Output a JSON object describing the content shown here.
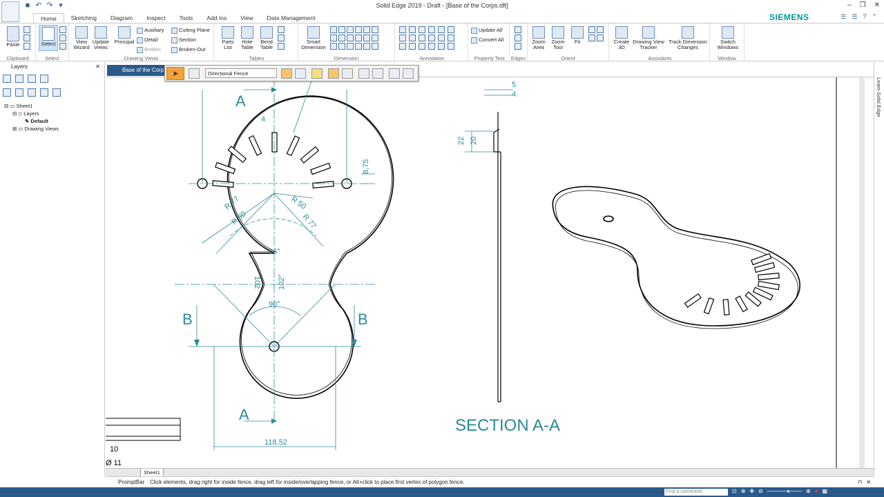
{
  "window": {
    "title": "Solid Edge 2019 - Draft - [Base of the Corps.dft]",
    "brand": "SIEMENS"
  },
  "tabs": [
    "Home",
    "Sketching",
    "Diagram",
    "Inspect",
    "Tools",
    "Add Ins",
    "View",
    "Data Management"
  ],
  "ribbon": {
    "clipboard": {
      "label": "Clipboard",
      "paste": "Paste"
    },
    "select": {
      "label": "Select",
      "select": "Select"
    },
    "drawing_views": {
      "label": "Drawing Views",
      "view_wizard_1": "View",
      "view_wizard_2": "Wizard",
      "update_views_1": "Update",
      "update_views_2": "Views",
      "principal": "Principal",
      "auxiliary": "Auxiliary",
      "detail": "Detail",
      "broken": "Broken",
      "cutting_plane": "Cutting Plane",
      "section": "Section",
      "broken_out": "Broken-Out"
    },
    "tables": {
      "label": "Tables",
      "parts_list_1": "Parts",
      "parts_list_2": "List",
      "hole_table_1": "Hole",
      "hole_table_2": "Table",
      "bend_table_1": "Bend",
      "bend_table_2": "Table"
    },
    "dimension": {
      "label": "Dimension",
      "smart_1": "Smart",
      "smart_2": "Dimension"
    },
    "annotation": {
      "label": "Annotation"
    },
    "property_text": {
      "label": "Property Text",
      "update_all": "Update All",
      "convert_all": "Convert All"
    },
    "edges": {
      "label": "Edges"
    },
    "orient": {
      "label": "Orient",
      "zoom_area_1": "Zoom",
      "zoom_area_2": "Area",
      "zoom_tool_1": "Zoom",
      "zoom_tool_2": "Tool",
      "fit": "Fit"
    },
    "assistants": {
      "label": "Assistants",
      "create3d_1": "Create",
      "create3d_2": "3D",
      "dvt_1": "Drawing View",
      "dvt_2": "Tracker",
      "tdc_1": "Track Dimension",
      "tdc_2": "Changes"
    },
    "window": {
      "label": "Window",
      "switch_1": "Switch",
      "switch_2": "Windows"
    }
  },
  "left_panel": {
    "title": "Layers",
    "tree": {
      "sheet": "Sheet1",
      "layers": "Layers",
      "default": "Default",
      "drawing_views": "Drawing Views"
    }
  },
  "doc_tab": "Base of the Corp",
  "selection_toolbar": {
    "mode": "Directional Fence"
  },
  "drawing": {
    "dims": {
      "r77a": "R 77",
      "r80": "R 80",
      "r50": "R 50",
      "r77b": "R 77",
      "a66": "66°",
      "a90": "90°",
      "d102a": "102",
      "d102b": "102°",
      "d4": "4",
      "d875": "8,75",
      "d11852": "118,52",
      "s5": "5",
      "s4": "4",
      "s22": "22",
      "s20": "20",
      "p10": "10",
      "p11": "Ø 11"
    },
    "labels": {
      "a_top": "A",
      "a_bottom": "A",
      "b_left": "B",
      "b_right": "B"
    },
    "section_title": "SECTION A-A"
  },
  "sheet_tab": "Sheet1",
  "prompt": {
    "label": "PromptBar",
    "message": "Click elements, drag right for inside fence, drag left for inside/overlapping fence, or Alt+click to place first vertex of polygon fence."
  },
  "status": {
    "find_placeholder": "Find a command"
  },
  "right_dock": {
    "learn": "Learn Solid Edge"
  }
}
